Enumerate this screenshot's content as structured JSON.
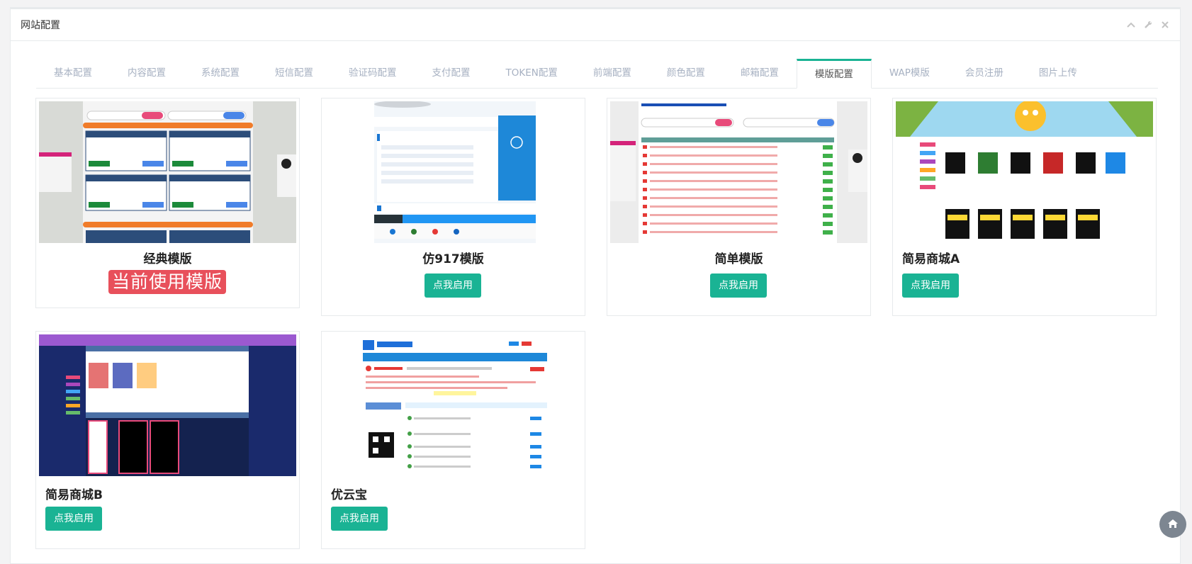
{
  "panel": {
    "title": "网站配置",
    "tools": [
      "chevron-up-icon",
      "wrench-icon",
      "close-icon"
    ]
  },
  "tabs": [
    {
      "label": "基本配置",
      "active": false
    },
    {
      "label": "内容配置",
      "active": false
    },
    {
      "label": "系统配置",
      "active": false
    },
    {
      "label": "短信配置",
      "active": false
    },
    {
      "label": "验证码配置",
      "active": false
    },
    {
      "label": "支付配置",
      "active": false
    },
    {
      "label": "TOKEN配置",
      "active": false
    },
    {
      "label": "前端配置",
      "active": false
    },
    {
      "label": "颜色配置",
      "active": false
    },
    {
      "label": "邮箱配置",
      "active": false
    },
    {
      "label": "模版配置",
      "active": true
    },
    {
      "label": "WAP模版",
      "active": false
    },
    {
      "label": "会员注册",
      "active": false
    },
    {
      "label": "图片上传",
      "active": false
    }
  ],
  "templates": [
    {
      "name": "经典模版",
      "status": "当前使用模版",
      "in_use": true
    },
    {
      "name": "仿917模版",
      "button": "点我启用",
      "in_use": false
    },
    {
      "name": "简单模版",
      "button": "点我启用",
      "in_use": false
    },
    {
      "name": "简易商城A",
      "button": "点我启用",
      "in_use": false
    },
    {
      "name": "简易商城B",
      "button": "点我启用",
      "in_use": false
    },
    {
      "name": "优云宝",
      "button": "点我启用",
      "in_use": false
    }
  ],
  "colors": {
    "accent": "#1ab394",
    "badge": "#e8505b"
  },
  "fab_icon": "home-icon"
}
